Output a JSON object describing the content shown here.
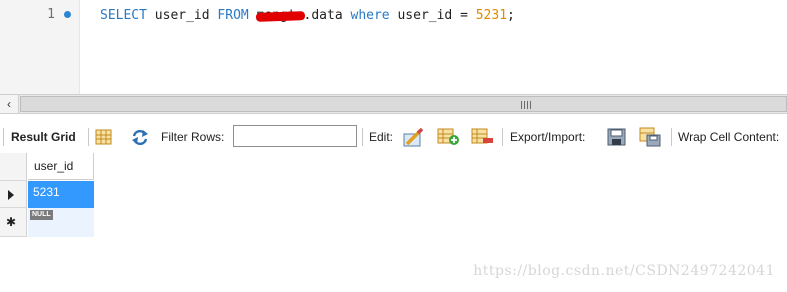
{
  "editor": {
    "line_number": "1",
    "sql": {
      "select": "SELECT",
      "column": " user_id ",
      "from": "FROM",
      "space": " ",
      "schema_redacted": "mengtu",
      "table": ".data",
      "space2": " ",
      "where": "where",
      "condition": " user_id = ",
      "value": "5231",
      "terminator": ";"
    }
  },
  "toolbar": {
    "result_grid": "Result Grid",
    "filter_rows": "Filter Rows:",
    "filter_value": "",
    "edit": "Edit:",
    "export_import": "Export/Import:",
    "wrap_cell": "Wrap Cell Content:"
  },
  "grid": {
    "columns": [
      "user_id"
    ],
    "rows": [
      {
        "user_id": "5231"
      }
    ],
    "null_label": "NULL"
  },
  "watermark": "https://blog.csdn.net/CSDN2497242041",
  "colors": {
    "keyword": "#2979c4",
    "number": "#e08a00",
    "selection": "#3399ff",
    "redaction": "#e10000"
  }
}
